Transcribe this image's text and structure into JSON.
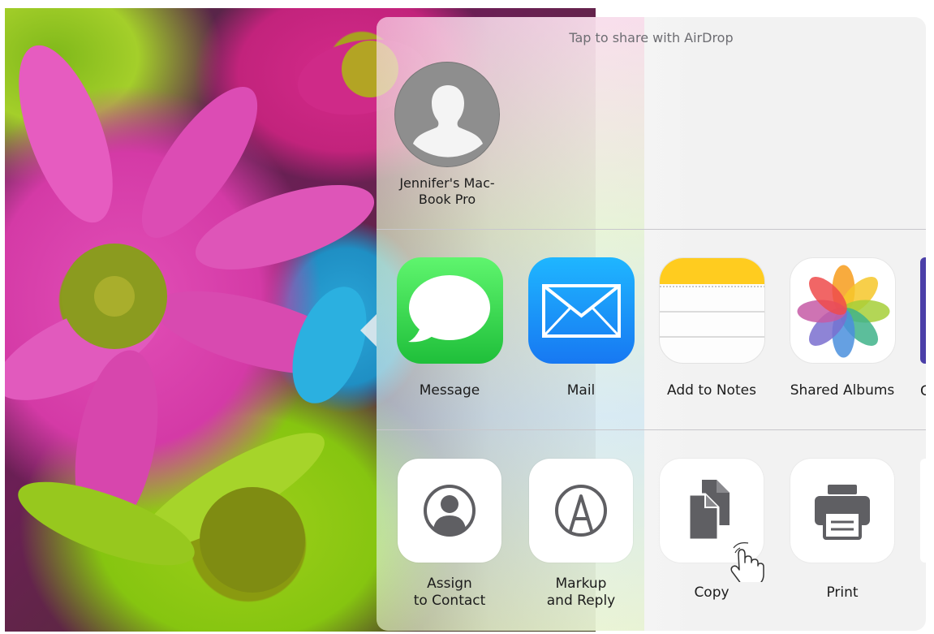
{
  "airdrop": {
    "title": "Tap to share with AirDrop",
    "person": {
      "name": "Jennifer's Mac-\nBook Pro",
      "icon": "person-silhouette-icon"
    }
  },
  "apps": [
    {
      "label": "Message",
      "icon": "message-icon",
      "color": "#34c84a"
    },
    {
      "label": "Mail",
      "icon": "mail-icon",
      "color": "#1a8cf5"
    },
    {
      "label": "Add to Notes",
      "icon": "notes-icon",
      "color": "#ffd426"
    },
    {
      "label": "Shared Albums",
      "icon": "photos-icon",
      "color": "#ffffff"
    },
    {
      "label": "C",
      "icon": "partial-app-icon",
      "color": "#4b3fa8"
    }
  ],
  "actions": [
    {
      "label": "Assign\nto Contact",
      "icon": "contact-icon"
    },
    {
      "label": "Markup\nand Reply",
      "icon": "markup-icon"
    },
    {
      "label": "Copy",
      "icon": "copy-icon"
    },
    {
      "label": "Print",
      "icon": "print-icon"
    }
  ],
  "colors": {
    "glyph": "#5f5f63",
    "label": "#1c1c1c",
    "secondary": "#6d6d72"
  }
}
